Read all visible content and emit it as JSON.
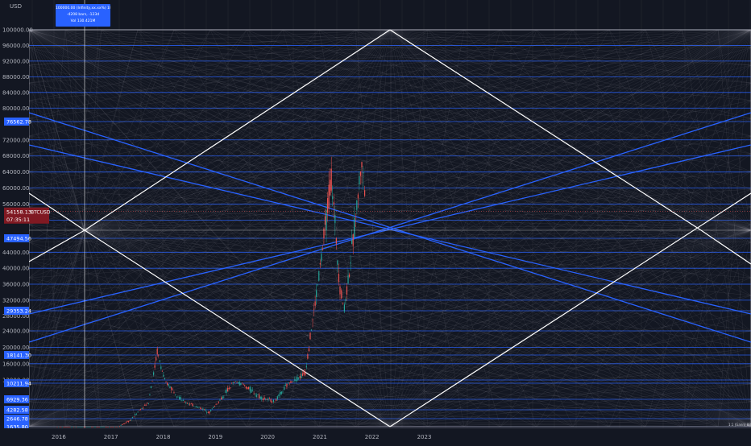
{
  "colors": {
    "background": "#131722",
    "grid_line": "#5d606b",
    "fan_blue": "#2962ff",
    "fan_white": "#ffffff",
    "candle_up": "#26a69a",
    "candle_down": "#ef5350",
    "price_tag_bg": "#2962ff",
    "current_price_bg": "#801922"
  },
  "icons": {},
  "chart_data": {
    "type": "candlestick",
    "currency_label": "USD",
    "symbol": "BTCUSD",
    "current_price": "54158.13",
    "countdown": "07:35:11",
    "x_tick_labels": [
      "2016",
      "2017",
      "2018",
      "2019",
      "2020",
      "2021",
      "2022",
      "2023"
    ],
    "y_tick_labels": [
      "100000.00",
      "96000.00",
      "92000.00",
      "88000.00",
      "84000.00",
      "80000.00",
      "72000.00",
      "68000.00",
      "64000.00",
      "60000.00",
      "56000.00",
      "44000.00",
      "40000.00",
      "36000.00",
      "32000.00",
      "28000.00",
      "24000.00",
      "20000.00",
      "16000.00",
      "12000.00"
    ],
    "price_levels": [
      "76562.78",
      "47494.56",
      "29353.24",
      "18141.30",
      "10211.94",
      "6929.36",
      "4282.58",
      "2646.78",
      "1635.80"
    ],
    "tooltip": {
      "line1": "100000.00 (Infinity,xx.xx%) 100000000",
      "line2": "-4208 bars, -123d",
      "line3": "Vol 130.421M"
    },
    "corner_note": "1:1 (Gann) 88",
    "price_series": [
      {
        "date": "2016-01",
        "close": 430
      },
      {
        "date": "2016-06",
        "close": 670
      },
      {
        "date": "2017-01",
        "close": 970
      },
      {
        "date": "2017-06",
        "close": 2500
      },
      {
        "date": "2017-10",
        "close": 6100
      },
      {
        "date": "2017-12",
        "close": 19000
      },
      {
        "date": "2018-02",
        "close": 10500
      },
      {
        "date": "2018-06",
        "close": 6400
      },
      {
        "date": "2018-12",
        "close": 3800
      },
      {
        "date": "2019-06",
        "close": 11000
      },
      {
        "date": "2019-12",
        "close": 7200
      },
      {
        "date": "2020-03",
        "close": 6400
      },
      {
        "date": "2020-07",
        "close": 11300
      },
      {
        "date": "2020-10",
        "close": 13800
      },
      {
        "date": "2020-12",
        "close": 29000
      },
      {
        "date": "2021-02",
        "close": 45000
      },
      {
        "date": "2021-04",
        "close": 63000
      },
      {
        "date": "2021-06",
        "close": 35000
      },
      {
        "date": "2021-07",
        "close": 30000
      },
      {
        "date": "2021-09",
        "close": 47000
      },
      {
        "date": "2021-11",
        "close": 67000
      },
      {
        "date": "2021-12",
        "close": 54158
      }
    ]
  }
}
